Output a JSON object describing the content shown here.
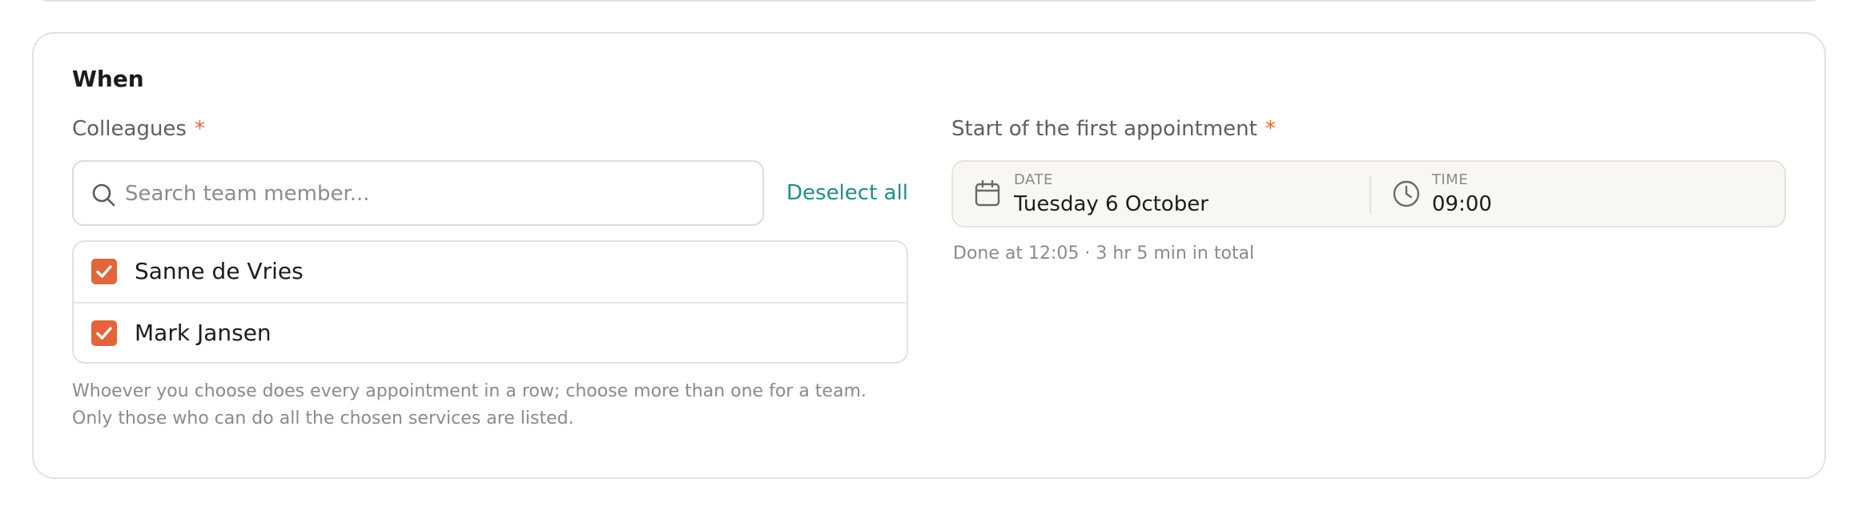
{
  "section": {
    "title": "When"
  },
  "colleagues": {
    "label": "Colleagues",
    "required_mark": "*",
    "search_placeholder": "Search team member...",
    "search_value": "",
    "deselect_label": "Deselect all",
    "items": [
      {
        "name": "Sanne de Vries",
        "checked": true
      },
      {
        "name": "Mark Jansen",
        "checked": true
      }
    ],
    "helper_lines": [
      "Whoever you choose does every appointment in a row; choose more than one for a team.",
      "Only those who can do all the chosen services are listed."
    ]
  },
  "start": {
    "label": "Start of the first appointment",
    "required_mark": "*",
    "date_caption": "DATE",
    "date_value": "Tuesday 6 October",
    "time_caption": "TIME",
    "time_value": "09:00",
    "done_text": "Done at 12:05 · 3 hr 5 min in total"
  },
  "colors": {
    "accent": "#e4643b",
    "link": "#1f8f84",
    "muted_text": "#8a8a8a"
  },
  "icons": {
    "search": "search-icon",
    "checkbox": "check-icon",
    "date": "calendar-icon",
    "time": "clock-icon"
  }
}
